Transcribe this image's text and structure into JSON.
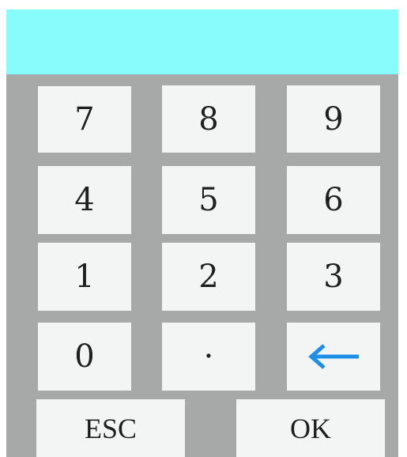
{
  "display": {
    "value": ""
  },
  "keys": {
    "k7": "7",
    "k8": "8",
    "k9": "9",
    "k4": "4",
    "k5": "5",
    "k6": "6",
    "k1": "1",
    "k2": "2",
    "k3": "3",
    "k0": "0",
    "dot": "·",
    "esc": "ESC",
    "ok": "OK"
  },
  "icons": {
    "backspace": "left-arrow-icon"
  },
  "colors": {
    "display_bg": "#86FDFC",
    "pad_bg": "#A7A9A9",
    "key_bg": "#F3F5F5",
    "arrow": "#1E8FE8"
  }
}
